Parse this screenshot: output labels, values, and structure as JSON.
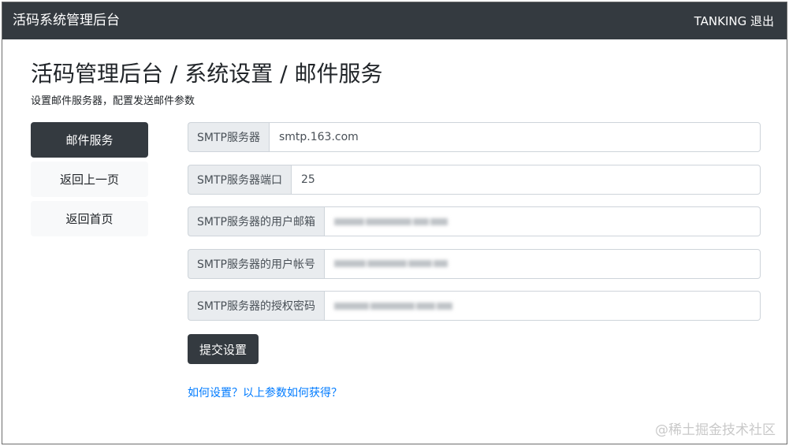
{
  "navbar": {
    "brand": "活码系统管理后台",
    "user_action": "TANKING 退出"
  },
  "page": {
    "title": "活码管理后台 / 系统设置 / 邮件服务",
    "subtitle": "设置邮件服务器，配置发送邮件参数"
  },
  "sidebar": {
    "items": [
      {
        "label": "邮件服务",
        "active": true
      },
      {
        "label": "返回上一页",
        "active": false
      },
      {
        "label": "返回首页",
        "active": false
      }
    ]
  },
  "form": {
    "fields": [
      {
        "label": "SMTP服务器",
        "value": "smtp.163.com"
      },
      {
        "label": "SMTP服务器端口",
        "value": "25"
      },
      {
        "label": "SMTP服务器的用户邮箱",
        "value": ""
      },
      {
        "label": "SMTP服务器的用户帐号",
        "value": ""
      },
      {
        "label": "SMTP服务器的授权密码",
        "value": ""
      }
    ],
    "submit_label": "提交设置",
    "help_link": "如何设置？以上参数如何获得？"
  },
  "watermark": "@稀土掘金技术社区",
  "colors": {
    "dark": "#343a40",
    "link": "#007bff",
    "addon_bg": "#e9ecef"
  }
}
